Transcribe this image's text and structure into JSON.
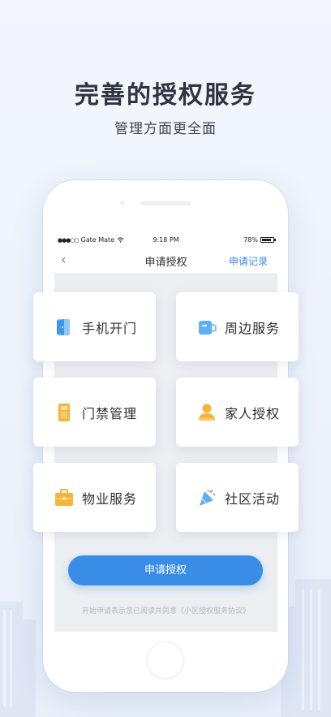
{
  "promo": {
    "headline": "完善的授权服务",
    "subline": "管理方面更全面"
  },
  "status_bar": {
    "carrier": "Gate Mate",
    "time": "9:18 PM",
    "battery": "78%"
  },
  "nav": {
    "title": "申请授权",
    "action": "申请记录"
  },
  "tiles": [
    {
      "label": "手机开门",
      "icon": "phone-door-icon"
    },
    {
      "label": "周边服务",
      "icon": "cup-icon"
    },
    {
      "label": "门禁管理",
      "icon": "access-card-icon"
    },
    {
      "label": "家人授权",
      "icon": "person-icon"
    },
    {
      "label": "物业服务",
      "icon": "briefcase-icon"
    },
    {
      "label": "社区活动",
      "icon": "party-horn-icon"
    }
  ],
  "cta_label": "申请授权",
  "agreement": "开始申请表示您已阅读并同意《小区授权服务协议》",
  "colors": {
    "accent": "#3a8de6",
    "icon_blue": "#5fb0f2",
    "icon_orange": "#f6b43c",
    "headline": "#2f3441"
  }
}
